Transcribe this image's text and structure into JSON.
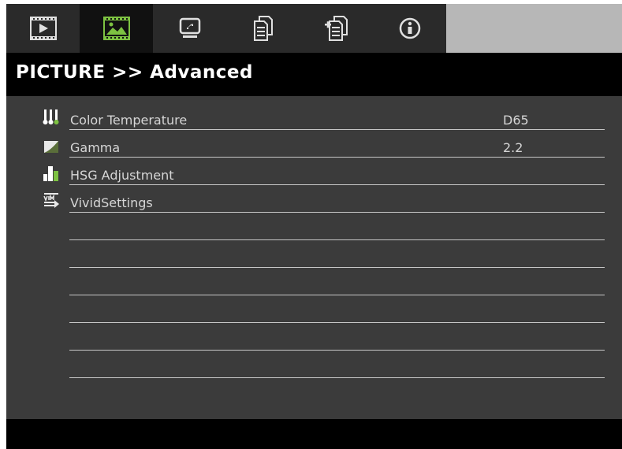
{
  "tabs": [
    {
      "name": "tab-image-settings",
      "icon": "play-screen-icon",
      "active": false
    },
    {
      "name": "tab-picture",
      "icon": "picture-icon",
      "active": true
    },
    {
      "name": "tab-display",
      "icon": "display-icon",
      "active": false
    },
    {
      "name": "tab-setup",
      "icon": "document-icon",
      "active": false
    },
    {
      "name": "tab-options",
      "icon": "document-plus-icon",
      "active": false
    },
    {
      "name": "tab-info",
      "icon": "info-icon",
      "active": false
    }
  ],
  "header": {
    "title": "PICTURE >> Advanced"
  },
  "menu": {
    "items": [
      {
        "label": "Color Temperature",
        "value": "D65",
        "icon": "thermometers-icon"
      },
      {
        "label": "Gamma",
        "value": "2.2",
        "icon": "gamma-curve-icon"
      },
      {
        "label": "HSG Adjustment",
        "value": "",
        "icon": "bar-levels-icon"
      },
      {
        "label": "VividSettings",
        "value": "",
        "icon": "vivid-settings-icon"
      }
    ],
    "empty_rows": 7
  },
  "colors": {
    "background": "#3b3b3b",
    "tab_active": "#111111",
    "title_bar": "#000000",
    "text": "#d6d6d6",
    "accent_green": "#7dc242"
  }
}
